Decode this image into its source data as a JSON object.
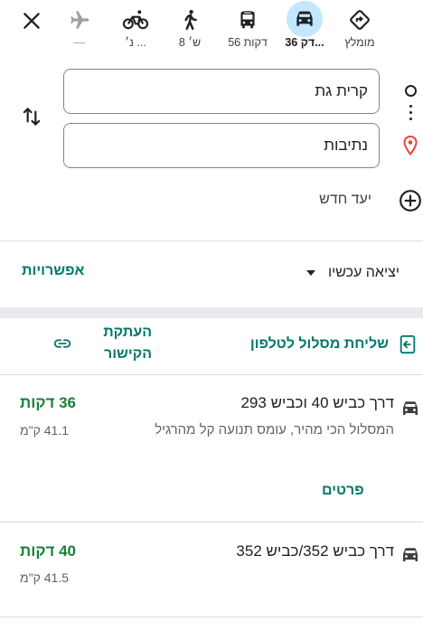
{
  "modes": [
    {
      "id": "best",
      "label": "מומלץ",
      "icon": "diamond-turn-icon",
      "active": false,
      "disabled": false
    },
    {
      "id": "drive",
      "label": "36 דק...",
      "icon": "car-icon",
      "active": true,
      "disabled": false
    },
    {
      "id": "transit",
      "label": "56 דקות",
      "icon": "bus-icon",
      "active": false,
      "disabled": false
    },
    {
      "id": "walk",
      "label": "8 ש׳",
      "icon": "walk-icon",
      "active": false,
      "disabled": false
    },
    {
      "id": "bike",
      "label": "נ׳ ...",
      "icon": "bike-icon",
      "active": false,
      "disabled": false
    },
    {
      "id": "flight",
      "label": "—",
      "icon": "plane-icon",
      "active": false,
      "disabled": true
    }
  ],
  "search": {
    "origin": "קרית גת",
    "destination": "נתיבות",
    "add_destination": "יעד חדש"
  },
  "depart": {
    "label": "יציאה עכשיו"
  },
  "options": {
    "label": "אפשרויות"
  },
  "share": {
    "send_label": "שליחת מסלול לטלפון",
    "copy_label": "העתקת הקישור"
  },
  "routes": [
    {
      "name": "דרך כביש 40 וכביש 293",
      "desc": "המסלול הכי מהיר, עומס תנועה קל מהרגיל",
      "time": "36 דקות",
      "distance": "41.1 ק\"מ",
      "details_label": "פרטים"
    },
    {
      "name": "דרך כביש 352/כביש 352",
      "desc": "",
      "time": "40 דקות",
      "distance": "41.5 ק\"מ",
      "details_label": ""
    }
  ],
  "colors": {
    "accent": "#00796b",
    "active_mode": "#c2e7ff",
    "time_green": "#188038",
    "pin_red": "#ea4335"
  }
}
